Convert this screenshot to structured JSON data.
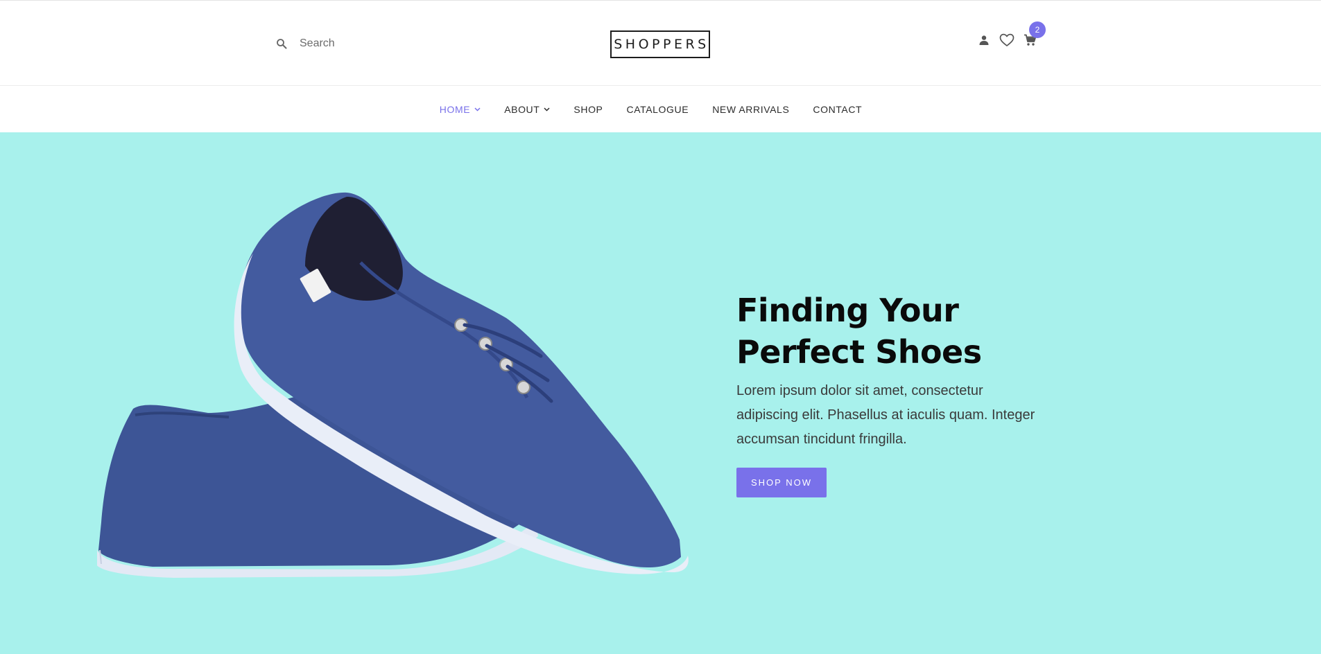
{
  "search": {
    "placeholder": "Search"
  },
  "brand": {
    "logo": "SHOPPERS"
  },
  "header_icons": [
    "person-icon",
    "heart-icon",
    "cart-icon"
  ],
  "cart": {
    "count": "2"
  },
  "nav": {
    "items": [
      {
        "label": "HOME",
        "has_dropdown": true,
        "active": true
      },
      {
        "label": "ABOUT",
        "has_dropdown": true,
        "active": false
      },
      {
        "label": "SHOP",
        "has_dropdown": false,
        "active": false
      },
      {
        "label": "CATALOGUE",
        "has_dropdown": false,
        "active": false
      },
      {
        "label": "NEW ARRIVALS",
        "has_dropdown": false,
        "active": false
      },
      {
        "label": "CONTACT",
        "has_dropdown": false,
        "active": false
      }
    ]
  },
  "hero": {
    "title_line1": "Finding Your",
    "title_line2": "Perfect Shoes",
    "text": "Lorem ipsum dolor sit amet, consectetur adipiscing elit. Phasellus at iaculis quam. Integer accumsan tincidunt fringilla.",
    "button_label": "SHOP NOW"
  },
  "colors": {
    "accent": "#7971ea",
    "hero_bg": "#a8f1ec",
    "shoe": "#3f5597",
    "sole": "#e9eef8"
  }
}
